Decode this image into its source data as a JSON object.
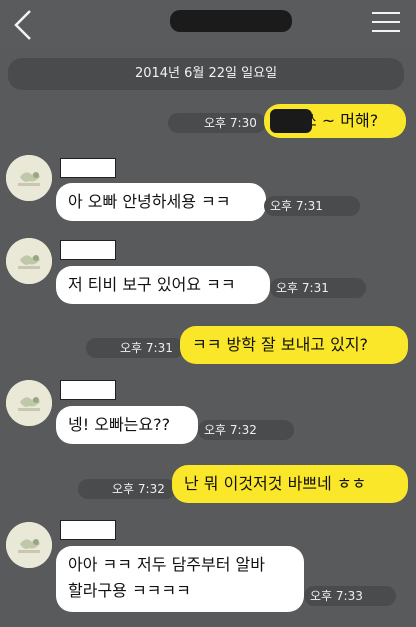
{
  "header": {
    "back_icon": "chevron-left-icon",
    "menu_icon": "hamburger-menu-icon"
  },
  "date_divider": "2014년 6월 22일 일요일",
  "messages": [
    {
      "side": "out",
      "text": "쓰 ~ 머해?",
      "time": "오후 7:30"
    },
    {
      "side": "in",
      "text": "아 오빠 안녕하세용 ㅋㅋ",
      "time": "오후 7:31"
    },
    {
      "side": "in",
      "text": "저 티비 보구 있어요 ㅋㅋ",
      "time": "오후 7:31"
    },
    {
      "side": "out",
      "text": "ㅋㅋ 방학 잘 보내고 있지?",
      "time": "오후 7:31"
    },
    {
      "side": "in",
      "text": "넹! 오빠는요??",
      "time": "오후 7:32"
    },
    {
      "side": "out",
      "text": "난 뭐 이것저것 바쁘네 ㅎㅎ",
      "time": "오후 7:32"
    },
    {
      "side": "in",
      "text_line1": "아아 ㅋㅋ 저두 담주부터 알바",
      "text_line2": "할라구용 ㅋㅋㅋㅋ",
      "time": "오후 7:33"
    }
  ],
  "colors": {
    "background": "#595a5c",
    "outgoing_bubble": "#fbe729",
    "incoming_bubble": "#ffffff"
  }
}
